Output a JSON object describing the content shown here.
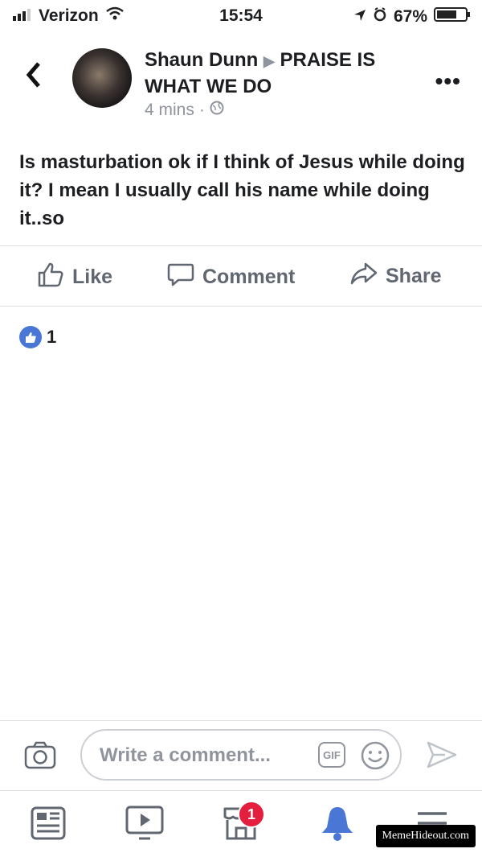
{
  "status_bar": {
    "carrier": "Verizon",
    "time": "15:54",
    "battery": "67%"
  },
  "post": {
    "author": "Shaun Dunn",
    "group": "PRAISE IS WHAT WE DO",
    "time_ago": "4 mins",
    "text": "Is masturbation ok if I think of Jesus while doing it? I mean I usually call his name while doing it..so"
  },
  "actions": {
    "like": "Like",
    "comment": "Comment",
    "share": "Share"
  },
  "reactions": {
    "count": "1"
  },
  "composer": {
    "placeholder": "Write a comment...",
    "gif_label": "GIF"
  },
  "tabbar": {
    "notifications_badge": "1"
  },
  "watermark": "MemeHideout.com",
  "colors": {
    "accent": "#4a76d6",
    "badge": "#e41e3f",
    "muted": "#606770"
  }
}
